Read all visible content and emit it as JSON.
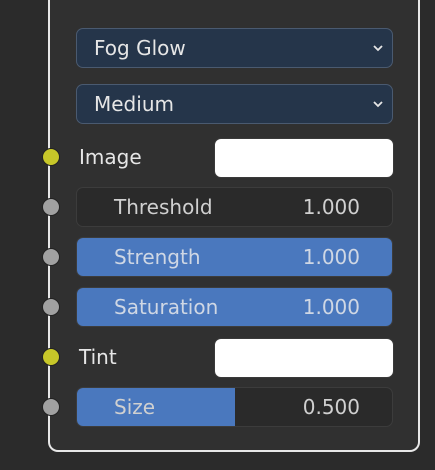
{
  "node": {
    "type_dropdown": {
      "value": "Fog Glow"
    },
    "quality_dropdown": {
      "value": "Medium"
    },
    "inputs": [
      {
        "label": "Image",
        "kind": "color",
        "socket_color": "#c7c729"
      },
      {
        "label": "Threshold",
        "kind": "slider",
        "value": "1.000",
        "fill_fraction": 0.0,
        "socket_color": "#a1a1a1"
      },
      {
        "label": "Strength",
        "kind": "slider",
        "value": "1.000",
        "fill_fraction": 1.0,
        "socket_color": "#a1a1a1"
      },
      {
        "label": "Saturation",
        "kind": "slider",
        "value": "1.000",
        "fill_fraction": 1.0,
        "socket_color": "#a1a1a1"
      },
      {
        "label": "Tint",
        "kind": "color",
        "socket_color": "#c7c729"
      },
      {
        "label": "Size",
        "kind": "slider",
        "value": "0.500",
        "fill_fraction": 0.5,
        "socket_color": "#a1a1a1"
      }
    ]
  },
  "colors": {
    "slider_fill": "#4a78be",
    "dropdown_bg": "#25354a",
    "color_swatch": "#ffffff"
  }
}
